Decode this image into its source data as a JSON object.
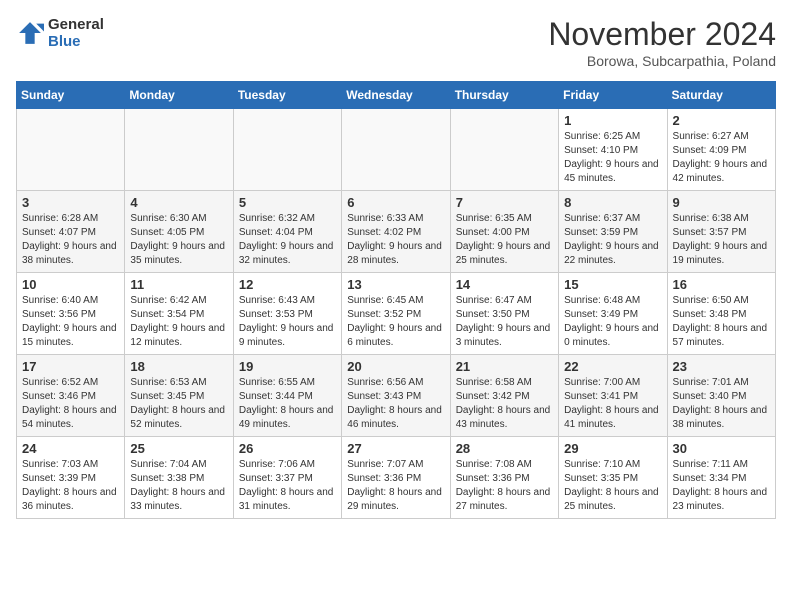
{
  "logo": {
    "line1": "General",
    "line2": "Blue"
  },
  "title": "November 2024",
  "subtitle": "Borowa, Subcarpathia, Poland",
  "days_header": [
    "Sunday",
    "Monday",
    "Tuesday",
    "Wednesday",
    "Thursday",
    "Friday",
    "Saturday"
  ],
  "weeks": [
    [
      {
        "day": "",
        "info": ""
      },
      {
        "day": "",
        "info": ""
      },
      {
        "day": "",
        "info": ""
      },
      {
        "day": "",
        "info": ""
      },
      {
        "day": "",
        "info": ""
      },
      {
        "day": "1",
        "info": "Sunrise: 6:25 AM\nSunset: 4:10 PM\nDaylight: 9 hours and 45 minutes."
      },
      {
        "day": "2",
        "info": "Sunrise: 6:27 AM\nSunset: 4:09 PM\nDaylight: 9 hours and 42 minutes."
      }
    ],
    [
      {
        "day": "3",
        "info": "Sunrise: 6:28 AM\nSunset: 4:07 PM\nDaylight: 9 hours and 38 minutes."
      },
      {
        "day": "4",
        "info": "Sunrise: 6:30 AM\nSunset: 4:05 PM\nDaylight: 9 hours and 35 minutes."
      },
      {
        "day": "5",
        "info": "Sunrise: 6:32 AM\nSunset: 4:04 PM\nDaylight: 9 hours and 32 minutes."
      },
      {
        "day": "6",
        "info": "Sunrise: 6:33 AM\nSunset: 4:02 PM\nDaylight: 9 hours and 28 minutes."
      },
      {
        "day": "7",
        "info": "Sunrise: 6:35 AM\nSunset: 4:00 PM\nDaylight: 9 hours and 25 minutes."
      },
      {
        "day": "8",
        "info": "Sunrise: 6:37 AM\nSunset: 3:59 PM\nDaylight: 9 hours and 22 minutes."
      },
      {
        "day": "9",
        "info": "Sunrise: 6:38 AM\nSunset: 3:57 PM\nDaylight: 9 hours and 19 minutes."
      }
    ],
    [
      {
        "day": "10",
        "info": "Sunrise: 6:40 AM\nSunset: 3:56 PM\nDaylight: 9 hours and 15 minutes."
      },
      {
        "day": "11",
        "info": "Sunrise: 6:42 AM\nSunset: 3:54 PM\nDaylight: 9 hours and 12 minutes."
      },
      {
        "day": "12",
        "info": "Sunrise: 6:43 AM\nSunset: 3:53 PM\nDaylight: 9 hours and 9 minutes."
      },
      {
        "day": "13",
        "info": "Sunrise: 6:45 AM\nSunset: 3:52 PM\nDaylight: 9 hours and 6 minutes."
      },
      {
        "day": "14",
        "info": "Sunrise: 6:47 AM\nSunset: 3:50 PM\nDaylight: 9 hours and 3 minutes."
      },
      {
        "day": "15",
        "info": "Sunrise: 6:48 AM\nSunset: 3:49 PM\nDaylight: 9 hours and 0 minutes."
      },
      {
        "day": "16",
        "info": "Sunrise: 6:50 AM\nSunset: 3:48 PM\nDaylight: 8 hours and 57 minutes."
      }
    ],
    [
      {
        "day": "17",
        "info": "Sunrise: 6:52 AM\nSunset: 3:46 PM\nDaylight: 8 hours and 54 minutes."
      },
      {
        "day": "18",
        "info": "Sunrise: 6:53 AM\nSunset: 3:45 PM\nDaylight: 8 hours and 52 minutes."
      },
      {
        "day": "19",
        "info": "Sunrise: 6:55 AM\nSunset: 3:44 PM\nDaylight: 8 hours and 49 minutes."
      },
      {
        "day": "20",
        "info": "Sunrise: 6:56 AM\nSunset: 3:43 PM\nDaylight: 8 hours and 46 minutes."
      },
      {
        "day": "21",
        "info": "Sunrise: 6:58 AM\nSunset: 3:42 PM\nDaylight: 8 hours and 43 minutes."
      },
      {
        "day": "22",
        "info": "Sunrise: 7:00 AM\nSunset: 3:41 PM\nDaylight: 8 hours and 41 minutes."
      },
      {
        "day": "23",
        "info": "Sunrise: 7:01 AM\nSunset: 3:40 PM\nDaylight: 8 hours and 38 minutes."
      }
    ],
    [
      {
        "day": "24",
        "info": "Sunrise: 7:03 AM\nSunset: 3:39 PM\nDaylight: 8 hours and 36 minutes."
      },
      {
        "day": "25",
        "info": "Sunrise: 7:04 AM\nSunset: 3:38 PM\nDaylight: 8 hours and 33 minutes."
      },
      {
        "day": "26",
        "info": "Sunrise: 7:06 AM\nSunset: 3:37 PM\nDaylight: 8 hours and 31 minutes."
      },
      {
        "day": "27",
        "info": "Sunrise: 7:07 AM\nSunset: 3:36 PM\nDaylight: 8 hours and 29 minutes."
      },
      {
        "day": "28",
        "info": "Sunrise: 7:08 AM\nSunset: 3:36 PM\nDaylight: 8 hours and 27 minutes."
      },
      {
        "day": "29",
        "info": "Sunrise: 7:10 AM\nSunset: 3:35 PM\nDaylight: 8 hours and 25 minutes."
      },
      {
        "day": "30",
        "info": "Sunrise: 7:11 AM\nSunset: 3:34 PM\nDaylight: 8 hours and 23 minutes."
      }
    ]
  ]
}
